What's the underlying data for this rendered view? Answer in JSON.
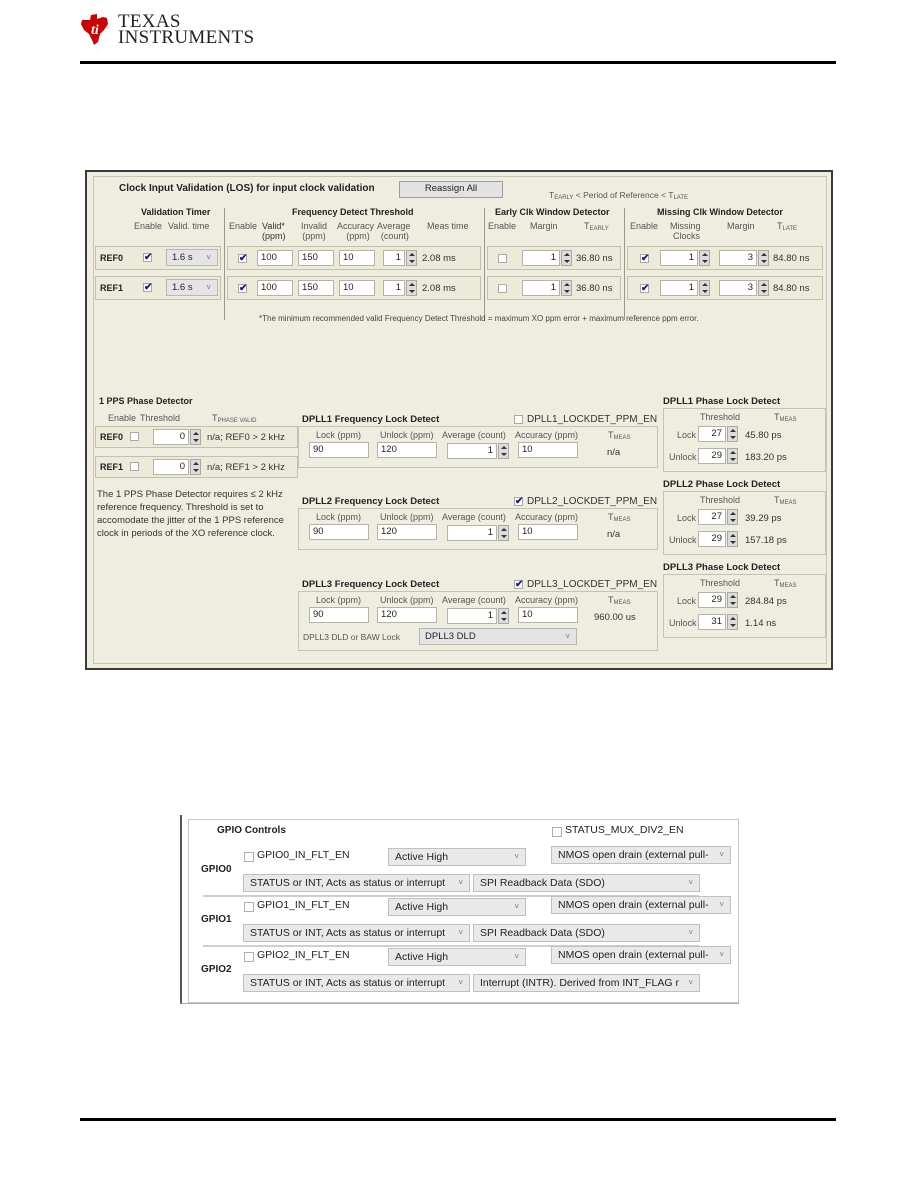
{
  "header": {
    "brand_line1": "Texas",
    "brand_line2": "Instruments"
  },
  "los_panel": {
    "title": "Clock Input Validation (LOS) for input clock validation",
    "reassign_all_label": "Reassign All",
    "period_note": {
      "t_early": "T",
      "early_sub": "EARLY",
      "mid": " < Period of Reference < T",
      "late_sub": "LATE"
    },
    "groups": {
      "validation_timer": "Validation Timer",
      "frequency_detect": "Frequency Detect Threshold",
      "early_clk": "Early Clk Window Detector",
      "missing_clk": "Missing Clk Window Detector"
    },
    "columns": {
      "enable": "Enable",
      "valid_time": "Valid. time",
      "valid_ppm_1": "Valid*",
      "valid_ppm_2": "(ppm)",
      "invalid_1": "Invalid",
      "invalid_2": "(ppm)",
      "accuracy_1": "Accuracy",
      "accuracy_2": "(ppm)",
      "average_1": "Average",
      "average_2": "(count)",
      "meas_time": "Meas time",
      "margin": "Margin",
      "t_early": "T",
      "t_early_sub": "EARLY",
      "missing_clocks_1": "Missing",
      "missing_clocks_2": "Clocks",
      "t_late": "T",
      "t_late_sub": "LATE"
    },
    "rows": [
      {
        "label": "REF0",
        "timer_enable": true,
        "valid_time": "1.6 s",
        "freq_enable": true,
        "valid_ppm": "100",
        "invalid_ppm": "150",
        "accuracy_ppm": "10",
        "average_count": "1",
        "meas_time": "2.08 ms",
        "early_enable": false,
        "early_margin": "1",
        "t_early": "36.80 ns",
        "missing_enable": true,
        "missing_clocks": "1",
        "late_margin": "3",
        "t_late": "84.80 ns"
      },
      {
        "label": "REF1",
        "timer_enable": true,
        "valid_time": "1.6 s",
        "freq_enable": true,
        "valid_ppm": "100",
        "invalid_ppm": "150",
        "accuracy_ppm": "10",
        "average_count": "1",
        "meas_time": "2.08 ms",
        "early_enable": false,
        "early_margin": "1",
        "t_early": "36.80 ns",
        "missing_enable": true,
        "missing_clocks": "1",
        "late_margin": "3",
        "t_late": "84.80 ns"
      }
    ],
    "footnote": "*The minimum recommended valid Frequency Detect Threshold = maximum XO ppm error + maximum reference ppm error."
  },
  "pps_detector": {
    "title": "1 PPS Phase Detector",
    "col_enable": "Enable",
    "col_threshold": "Threshold",
    "col_t": "T",
    "col_t_sub": "PHASE VALID",
    "rows": [
      {
        "label": "REF0",
        "enabled": false,
        "threshold": "0",
        "t_value": "n/a; REF0 > 2 kHz"
      },
      {
        "label": "REF1",
        "enabled": false,
        "threshold": "0",
        "t_value": "n/a; REF1 > 2 kHz"
      }
    ],
    "note_lines": [
      "The 1 PPS Phase Detector requires ≤ 2 kHz",
      "reference frequency. Threshold is set to",
      "accomodate the jitter of the 1 PPS reference",
      "clock in periods of the XO reference clock."
    ]
  },
  "freq_lock": {
    "col_lock": "Lock (ppm)",
    "col_unlock": "Unlock (ppm)",
    "col_average": "Average (count)",
    "col_accuracy": "Accuracy (ppm)",
    "col_t": "T",
    "col_t_sub": "MEAS",
    "dplls": [
      {
        "title": "DPLL1 Frequency Lock Detect",
        "en_label": "DPLL1_LOCKDET_PPM_EN",
        "en": false,
        "lock": "90",
        "unlock": "120",
        "average": "1",
        "accuracy": "10",
        "t_meas": "n/a"
      },
      {
        "title": "DPLL2 Frequency Lock Detect",
        "en_label": "DPLL2_LOCKDET_PPM_EN",
        "en": true,
        "lock": "90",
        "unlock": "120",
        "average": "1",
        "accuracy": "10",
        "t_meas": "n/a"
      },
      {
        "title": "DPLL3 Frequency Lock Detect",
        "en_label": "DPLL3_LOCKDET_PPM_EN",
        "en": true,
        "lock": "90",
        "unlock": "120",
        "average": "1",
        "accuracy": "10",
        "t_meas": "960.00 us"
      }
    ],
    "dpll3_dld_label": "DPLL3 DLD or BAW Lock",
    "dpll3_dld_value": "DPLL3 DLD"
  },
  "phase_lock": {
    "col_threshold": "Threshold",
    "col_t": "T",
    "col_t_sub": "MEAS",
    "lock_label": "Lock",
    "unlock_label": "Unlock",
    "dplls": [
      {
        "title": "DPLL1 Phase Lock Detect",
        "lock_threshold": "27",
        "lock_t": "45.80 ps",
        "unlock_threshold": "29",
        "unlock_t": "183.20 ps"
      },
      {
        "title": "DPLL2 Phase Lock Detect",
        "lock_threshold": "27",
        "lock_t": "39.29 ps",
        "unlock_threshold": "29",
        "unlock_t": "157.18 ps"
      },
      {
        "title": "DPLL3 Phase Lock Detect",
        "lock_threshold": "29",
        "lock_t": "284.84 ps",
        "unlock_threshold": "31",
        "unlock_t": "1.14 ns"
      }
    ]
  },
  "gpio": {
    "title": "GPIO Controls",
    "status_mux_label": "STATUS_MUX_DIV2_EN",
    "status_mux_checked": false,
    "rows": [
      {
        "label": "GPIO0",
        "flt_label": "GPIO0_IN_FLT_EN",
        "flt_checked": false,
        "polarity": "Active High",
        "drive": "NMOS open drain (external pull-",
        "mode": "STATUS or INT, Acts as status or interrupt",
        "function": "SPI Readback Data (SDO)"
      },
      {
        "label": "GPIO1",
        "flt_label": "GPIO1_IN_FLT_EN",
        "flt_checked": false,
        "polarity": "Active High",
        "drive": "NMOS open drain (external pull-",
        "mode": "STATUS or INT, Acts as status or interrupt",
        "function": "SPI Readback Data (SDO)"
      },
      {
        "label": "GPIO2",
        "flt_label": "GPIO2_IN_FLT_EN",
        "flt_checked": false,
        "polarity": "Active High",
        "drive": "NMOS open drain (external pull-",
        "mode": "STATUS or INT, Acts as status or interrupt",
        "function": "Interrupt (INTR). Derived from INT_FLAG r"
      }
    ]
  },
  "colors": {
    "brand_red": "#cc0000",
    "panel_bg": "#efede0",
    "check_mark": "#1b1b8f"
  }
}
